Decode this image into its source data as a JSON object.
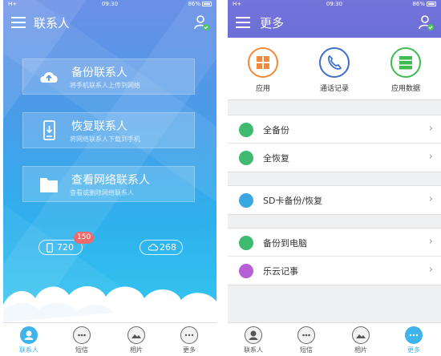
{
  "left": {
    "status": {
      "signal": "H+",
      "time": "09:30",
      "battery": "86%"
    },
    "title": "联系人",
    "actions": [
      {
        "title": "备份联系人",
        "subtitle": "将手机联系人上传到网络",
        "icon": "cloud-upload-icon"
      },
      {
        "title": "恢复联系人",
        "subtitle": "将网络联系人下载到手机",
        "icon": "phone-download-icon"
      },
      {
        "title": "查看网络联系人",
        "subtitle": "查看或删除网络联系人",
        "icon": "folder-icon"
      }
    ],
    "local_count": "720",
    "cloud_count": "268",
    "badge": "150",
    "tabs": [
      {
        "label": "联系人",
        "icon": "person-icon",
        "active": true
      },
      {
        "label": "短信",
        "icon": "message-icon",
        "active": false
      },
      {
        "label": "相片",
        "icon": "photo-icon",
        "active": false
      },
      {
        "label": "更多",
        "icon": "more-icon",
        "active": false
      }
    ]
  },
  "right": {
    "status": {
      "signal": "H+",
      "time": "09:30",
      "battery": "86%"
    },
    "title": "更多",
    "quick": [
      {
        "label": "应用",
        "icon": "apps-icon",
        "color": "#f08a3c"
      },
      {
        "label": "通话记录",
        "icon": "phone-icon",
        "color": "#3f6fc9"
      },
      {
        "label": "应用数据",
        "icon": "database-icon",
        "color": "#3fbb4f"
      }
    ],
    "groups": [
      [
        {
          "label": "全备份",
          "icon": "full-backup-icon",
          "color": "#3fbb6f"
        },
        {
          "label": "全恢复",
          "icon": "full-restore-icon",
          "color": "#3fbb6f"
        }
      ],
      [
        {
          "label": "SD卡备份/恢复",
          "icon": "sd-card-icon",
          "color": "#3aa8e0"
        }
      ],
      [
        {
          "label": "备份到电脑",
          "icon": "computer-icon",
          "color": "#3fbb6f"
        },
        {
          "label": "乐云记事",
          "icon": "note-icon",
          "color": "#b65fd6"
        }
      ]
    ],
    "tabs": [
      {
        "label": "联系人",
        "icon": "person-icon",
        "active": false
      },
      {
        "label": "短信",
        "icon": "message-icon",
        "active": false
      },
      {
        "label": "相片",
        "icon": "photo-icon",
        "active": false
      },
      {
        "label": "更多",
        "icon": "more-icon",
        "active": true
      }
    ]
  }
}
